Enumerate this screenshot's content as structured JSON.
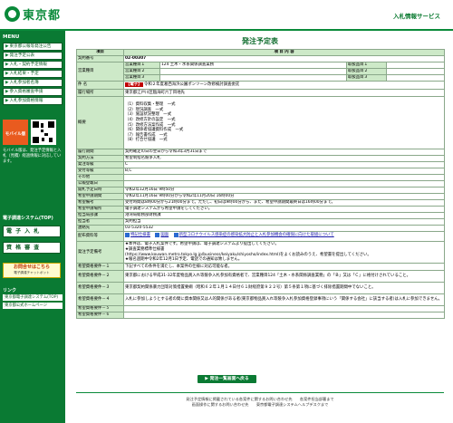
{
  "header": {
    "logo_text": "東京都",
    "service": "入札情報サービス"
  },
  "sidebar": {
    "menu_head": "MENU",
    "items": [
      {
        "label": "東京都公報等発注公告"
      },
      {
        "label": "発注予定公表"
      },
      {
        "label": "入札・契約予定情報"
      },
      {
        "label": "入札結果・予定"
      },
      {
        "label": "入札参加者名簿"
      },
      {
        "label": "参入資格審査申請"
      },
      {
        "label": "入札参加資格情報"
      }
    ],
    "mobile_label": "モバイル版",
    "mobile_note": "モバイル版は、発注予定情報と入札（見積）経過情報に対応しています。",
    "portal_label": "電子調達システム(TOP)",
    "btn1": "電 子 入 札",
    "btn2": "資 格 審 査",
    "check_title": "お問合せはこちら",
    "check_sub": "電子調達チャットボット",
    "links_head": "リンク",
    "links": [
      {
        "label": "東京都電子調達システム(TOP)"
      },
      {
        "label": "東京都公式ホームページ"
      }
    ]
  },
  "main": {
    "title": "発注予定表",
    "hdr_item": "項目",
    "hdr_content": "項 目 内 容",
    "rows": {
      "contract_no_label": "契約番号",
      "contract_no": "02-00307",
      "type_label": "営業種目",
      "type_subs": [
        "営業種目１",
        "営業種目２",
        "営業種目３"
      ],
      "type_values": [
        "124 土木・水系関係調査業務",
        "",
        ""
      ],
      "sub_labels": [
        "取扱品目１",
        "取扱品目２",
        "取扱品目３"
      ],
      "name_label": "件 名",
      "name_tag": "【電子】",
      "name_value": "令和２年度葛西海浜公園ポンツーン改修検討調査委託",
      "place_label": "履行場所",
      "place_value": "東京都江戸川区臨海町六丁目地先",
      "summary_label": "概要",
      "summary_lines": [
        "（1）資料収集・整理　一式",
        "（2）現況調査　一式",
        "（3）施設状況整理　一式",
        "（4）改修方針の設定　一式",
        "（5）改修方法案作成　一式",
        "（6）関係者協議資料作成　一式",
        "（7）報告書作成　一式",
        "（8）打合せ協議　一式"
      ],
      "period_label": "履行期間",
      "period_value": "契約確定の日の翌日から令和3年3月31日まで",
      "method_label": "契約方法",
      "method_value": "希望制指名競争入札",
      "grade_label": "発注等級",
      "grade_value": "C",
      "accept_label": "受付等級",
      "accept_value": "B,C",
      "other_label": "その他",
      "other_value": "",
      "pubdate_label": "公報登載日",
      "pubdate_value": "",
      "open_label": "開札予定日時",
      "open_value": "令和2年12月16日 9時50分",
      "app_label": "希望申請期間",
      "app_value": "令和2年11月16日 9時00分から令和2年11月20日 16時00分",
      "app_note_label": "希望備考",
      "app_note_value": "受付時間は8時00分から21時00分まで。ただし、初日は9時00分から、また、希望申請期間最終日は16時00分まで。",
      "sys_label": "希望申請場所",
      "sys_value": "電子調達システムから希望申請をしてください。",
      "dept_label": "担当局部課",
      "dept_value": "港湾局総務部財務課",
      "person_label": "担当者",
      "person_value": "契約担当",
      "tel_label": "連絡先",
      "tel_value": "03-5320-5532",
      "files_label": "配布資料等",
      "files": [
        "特記仕様書",
        "図面",
        "新型コロナウイルス感染症の感染拡大防止と入札参加機会の確保に向けた取組について"
      ],
      "remarks_label": "発注予定備考",
      "remarks_lines": [
        "★本件は、電子入札案件です。希望申請は、電子調達システムより提出してください。",
        "★調査業務標準仕様書",
        "(https://www.kouwan.metro.tokyo.lg.jp/business/keiyaku/shiyosho/index.html)をよくお読みのうえ、希望書を提出してください。",
        "★報名過期中令和2年12月1日予定、電話での通知は致しません。"
      ],
      "conds": [
        {
          "label": "希望資格要件－１",
          "value": "下記すべての条件を満たし、本案件の仕様に対応可能な者。"
        },
        {
          "label": "希望資格要件－２",
          "value": "東京都における平成31-32年度物品買入れ等競争入札参加有資格者で、営業種目124「土木・水系関係調査業務」の「Ｂ」又は「Ｃ」に格付けされていること。"
        },
        {
          "label": "希望資格要件－３",
          "value": "東京都契約関係暴力団等対策措置要綱（昭和６２年１月１４日付６１財経庶第９２２号）第５条第１項に基づく排除措置期間中でないこと。"
        },
        {
          "label": "希望資格要件－４",
          "value": "入札に参加しようとする者の間に資本関係又は人的関係がある者(東京都物品買入れ等競争入札参加資格登録事項にいう「関係する会社」に該当する者)は入札に参加できません。"
        },
        {
          "label": "希望資格要件－５",
          "value": ""
        },
        {
          "label": "希望資格要件－６",
          "value": ""
        }
      ]
    },
    "back_button": "発注一覧画面へ戻る"
  },
  "footer": {
    "line1": "発注予定情報に掲載されている各案件に関するお問い合わせ先　　各案件担当部署まで",
    "line2": "画面操作に関するお問い合わせ先　　東京都電子調達システムヘルプデスクまで"
  }
}
